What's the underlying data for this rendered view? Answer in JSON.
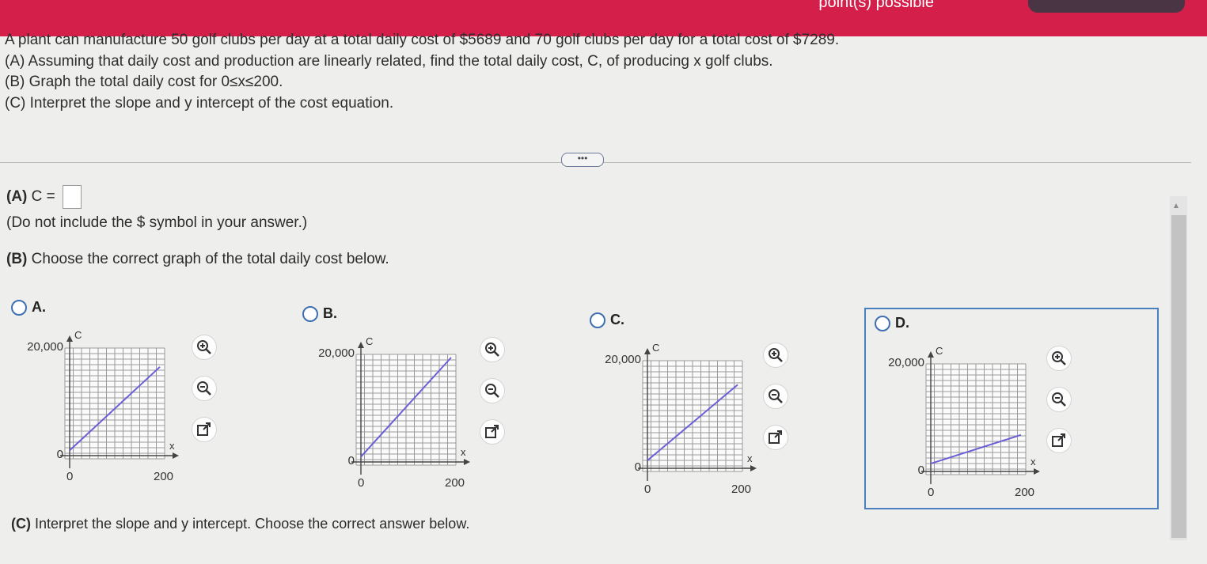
{
  "header": {
    "points_text": "point(s) possible"
  },
  "problem": {
    "line1": "A plant can manufacture 50 golf clubs per day at a total daily cost of $5689 and 70 golf clubs  per day for a total cost of $7289.",
    "line2": "(A) Assuming that daily cost and production are linearly related, find the total daily cost, C, of producing x golf clubs.",
    "line3": "(B) Graph the total daily cost for 0≤x≤200.",
    "line4": "(C) Interpret the slope and y intercept of the cost equation."
  },
  "more_button": "•••",
  "partA": {
    "label": "(A)",
    "text": "C ="
  },
  "note": "(Do not include the $ symbol in your answer.)",
  "partB": {
    "label": "(B)",
    "text": "Choose the correct graph of the total daily cost below."
  },
  "partC": {
    "label": "(C)",
    "text": "Interpret the slope and y intercept. Choose the correct answer below."
  },
  "options": [
    {
      "label": "A.",
      "ymax_label": "20,000",
      "y0_label": "0",
      "x0_label": "0",
      "xmax_label": "200",
      "x_axis": "x",
      "y_axis": "C"
    },
    {
      "label": "B.",
      "ymax_label": "20,000",
      "y0_label": "0",
      "x0_label": "0",
      "xmax_label": "200",
      "x_axis": "x",
      "y_axis": "C"
    },
    {
      "label": "C.",
      "ymax_label": "20,000",
      "y0_label": "0",
      "x0_label": "0",
      "xmax_label": "200",
      "x_axis": "x",
      "y_axis": "C"
    },
    {
      "label": "D.",
      "ymax_label": "20,000",
      "y0_label": "0",
      "x0_label": "0",
      "xmax_label": "200",
      "x_axis": "x",
      "y_axis": "C"
    }
  ],
  "chart_data": [
    {
      "type": "line",
      "title": "",
      "xlabel": "x",
      "ylabel": "C",
      "xlim": [
        0,
        200
      ],
      "ylim": [
        0,
        20000
      ],
      "grid": true,
      "x": [
        0,
        200
      ],
      "y": [
        1000,
        17000
      ],
      "line_color": "#6b5fd8"
    },
    {
      "type": "line",
      "title": "",
      "xlabel": "x",
      "ylabel": "C",
      "xlim": [
        0,
        200
      ],
      "ylim": [
        0,
        20000
      ],
      "grid": true,
      "x": [
        0,
        200
      ],
      "y": [
        1000,
        20000
      ],
      "line_color": "#6b5fd8"
    },
    {
      "type": "line",
      "title": "",
      "xlabel": "x",
      "ylabel": "C",
      "xlim": [
        0,
        200
      ],
      "ylim": [
        0,
        20000
      ],
      "grid": true,
      "x": [
        0,
        200
      ],
      "y": [
        1500,
        16000
      ],
      "line_color": "#6b5fd8"
    },
    {
      "type": "line",
      "title": "",
      "xlabel": "x",
      "ylabel": "C",
      "xlim": [
        0,
        200
      ],
      "ylim": [
        0,
        20000
      ],
      "grid": true,
      "x": [
        0,
        200
      ],
      "y": [
        1500,
        7000
      ],
      "line_color": "#6b5fd8"
    }
  ],
  "icons": {
    "zoom_in": "zoom-in-icon",
    "zoom_out": "zoom-out-icon",
    "open_new": "open-new-window-icon"
  }
}
